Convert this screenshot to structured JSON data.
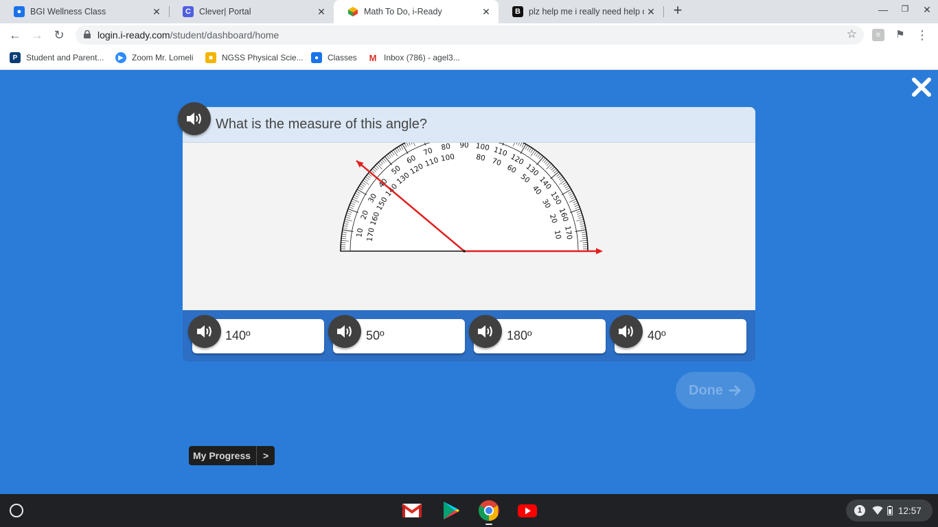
{
  "browser": {
    "tabs": [
      {
        "title": "BGI Wellness Class",
        "icon": "classroom-icon",
        "active": false
      },
      {
        "title": "Clever| Portal",
        "icon": "clever-icon",
        "active": false
      },
      {
        "title": "Math To Do, i-Ready",
        "icon": "iready-icon",
        "active": true
      },
      {
        "title": "plz help me i really need help on",
        "icon": "brainly-icon",
        "active": false
      }
    ],
    "url_host": "login.i-ready.com",
    "url_path": "/student/dashboard/home",
    "bookmarks": [
      {
        "label": "Student and Parent...",
        "icon": "powerschool-icon"
      },
      {
        "label": "Zoom Mr. Lomeli",
        "icon": "zoom-icon"
      },
      {
        "label": "NGSS Physical Scie...",
        "icon": "slides-icon"
      },
      {
        "label": "Classes",
        "icon": "classroom-icon"
      },
      {
        "label": "Inbox (786) - agel3...",
        "icon": "gmail-icon"
      }
    ]
  },
  "question": {
    "text": "What is the measure of this angle?",
    "outer_scale_labels": [
      "10",
      "20",
      "30",
      "40",
      "50",
      "60",
      "70",
      "80",
      "90",
      "100",
      "110",
      "120",
      "130",
      "140",
      "150",
      "160",
      "170"
    ],
    "inner_scale_labels": [
      "170",
      "160",
      "150",
      "140",
      "130",
      "120",
      "110",
      "100",
      "80",
      "70",
      "60",
      "50",
      "40",
      "30",
      "20",
      "10"
    ],
    "angle_ray_degrees": 140
  },
  "answers": [
    {
      "label": "140º"
    },
    {
      "label": "50º"
    },
    {
      "label": "180º"
    },
    {
      "label": "40º"
    }
  ],
  "done_label": "Done",
  "progress": {
    "label": "My Progress",
    "arrow": ">"
  },
  "taskbar": {
    "apps": [
      "gmail-icon",
      "play-store-icon",
      "chrome-icon",
      "youtube-icon"
    ],
    "notification_count": "1",
    "time": "12:57"
  },
  "colors": {
    "background": "#2a7cd8",
    "ray": "#e0201e",
    "answer_band": "#2d6fc4"
  }
}
